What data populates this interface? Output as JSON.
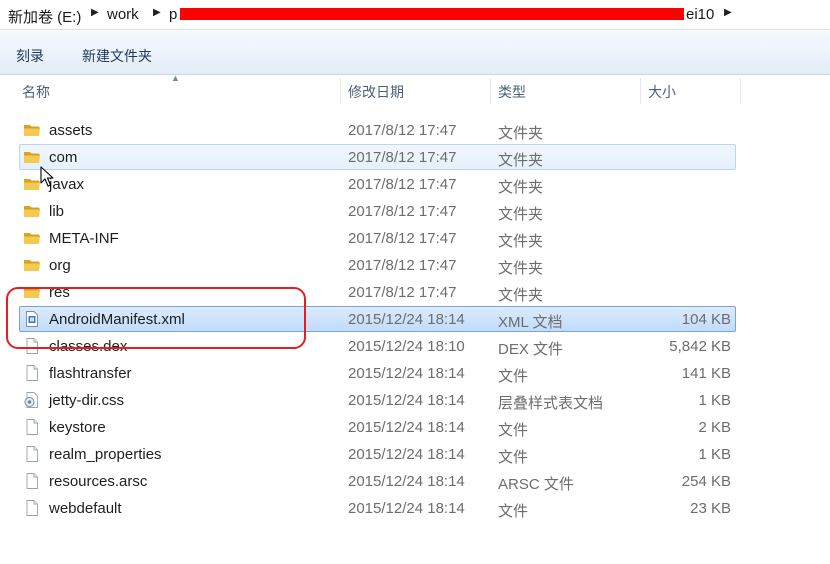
{
  "address": {
    "segments": [
      "新加卷 (E:)",
      "work",
      "p",
      "ei10"
    ]
  },
  "toolbar": {
    "burn_label": "刻录",
    "new_folder_label": "新建文件夹"
  },
  "columns": {
    "name": "名称",
    "date": "修改日期",
    "type": "类型",
    "size": "大小"
  },
  "files": [
    {
      "name": "assets",
      "date": "2017/8/12 17:47",
      "type": "文件夹",
      "size": "",
      "icon": "folder-icon"
    },
    {
      "name": "com",
      "date": "2017/8/12 17:47",
      "type": "文件夹",
      "size": "",
      "icon": "folder-icon"
    },
    {
      "name": "javax",
      "date": "2017/8/12 17:47",
      "type": "文件夹",
      "size": "",
      "icon": "folder-icon"
    },
    {
      "name": "lib",
      "date": "2017/8/12 17:47",
      "type": "文件夹",
      "size": "",
      "icon": "folder-icon"
    },
    {
      "name": "META-INF",
      "date": "2017/8/12 17:47",
      "type": "文件夹",
      "size": "",
      "icon": "folder-icon"
    },
    {
      "name": "org",
      "date": "2017/8/12 17:47",
      "type": "文件夹",
      "size": "",
      "icon": "folder-icon"
    },
    {
      "name": "res",
      "date": "2017/8/12 17:47",
      "type": "文件夹",
      "size": "",
      "icon": "folder-icon"
    },
    {
      "name": "AndroidManifest.xml",
      "date": "2015/12/24 18:14",
      "type": "XML 文档",
      "size": "104 KB",
      "icon": "xml-file-icon"
    },
    {
      "name": "classes.dex",
      "date": "2015/12/24 18:10",
      "type": "DEX 文件",
      "size": "5,842 KB",
      "icon": "file-icon"
    },
    {
      "name": "flashtransfer",
      "date": "2015/12/24 18:14",
      "type": "文件",
      "size": "141 KB",
      "icon": "file-icon"
    },
    {
      "name": "jetty-dir.css",
      "date": "2015/12/24 18:14",
      "type": "层叠样式表文档",
      "size": "1 KB",
      "icon": "css-file-icon"
    },
    {
      "name": "keystore",
      "date": "2015/12/24 18:14",
      "type": "文件",
      "size": "2 KB",
      "icon": "file-icon"
    },
    {
      "name": "realm_properties",
      "date": "2015/12/24 18:14",
      "type": "文件",
      "size": "1 KB",
      "icon": "file-icon"
    },
    {
      "name": "resources.arsc",
      "date": "2015/12/24 18:14",
      "type": "ARSC 文件",
      "size": "254 KB",
      "icon": "file-icon"
    },
    {
      "name": "webdefault",
      "date": "2015/12/24 18:14",
      "type": "文件",
      "size": "23 KB",
      "icon": "file-icon"
    }
  ],
  "state": {
    "hovered_item": "com",
    "selected_item": "AndroidManifest.xml"
  },
  "colors": {
    "annotation": "#e32020",
    "redaction": "#ff0000",
    "folder": "#e8b93c"
  }
}
